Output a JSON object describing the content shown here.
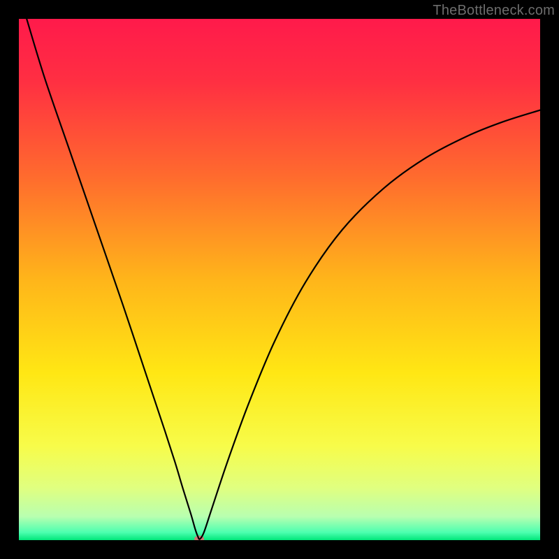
{
  "watermark": "TheBottleneck.com",
  "chart_data": {
    "type": "line",
    "title": "",
    "xlabel": "",
    "ylabel": "",
    "xlim": [
      0,
      100
    ],
    "ylim": [
      0,
      100
    ],
    "background_gradient": {
      "stops": [
        {
          "offset": 0.0,
          "color": "#ff1a4b"
        },
        {
          "offset": 0.12,
          "color": "#ff2f42"
        },
        {
          "offset": 0.3,
          "color": "#ff6a2e"
        },
        {
          "offset": 0.5,
          "color": "#ffb51a"
        },
        {
          "offset": 0.68,
          "color": "#ffe714"
        },
        {
          "offset": 0.82,
          "color": "#f7fc4a"
        },
        {
          "offset": 0.9,
          "color": "#e0ff80"
        },
        {
          "offset": 0.955,
          "color": "#b8ffb0"
        },
        {
          "offset": 0.985,
          "color": "#4dffb0"
        },
        {
          "offset": 1.0,
          "color": "#00e67a"
        }
      ]
    },
    "series": [
      {
        "name": "bottleneck-curve",
        "stroke": "#000000",
        "stroke_width": 2.2,
        "x": [
          1.5,
          5,
          10,
          15,
          20,
          25,
          28,
          30,
          31.5,
          33,
          33.8,
          34.3,
          34.7,
          35.5,
          37,
          40,
          44,
          49,
          55,
          62,
          70,
          78,
          86,
          93,
          100
        ],
        "y": [
          100,
          88.5,
          74,
          59.5,
          45,
          30,
          21,
          14.8,
          9.8,
          5,
          2.2,
          0.8,
          0.2,
          1.5,
          6,
          15,
          26,
          38,
          49.5,
          59.5,
          67.5,
          73.3,
          77.5,
          80.3,
          82.5
        ]
      }
    ],
    "marker": {
      "name": "minimum-marker",
      "x": 34.6,
      "y": 0.2,
      "rx": 7,
      "ry": 5,
      "color": "#cf7a76"
    }
  }
}
